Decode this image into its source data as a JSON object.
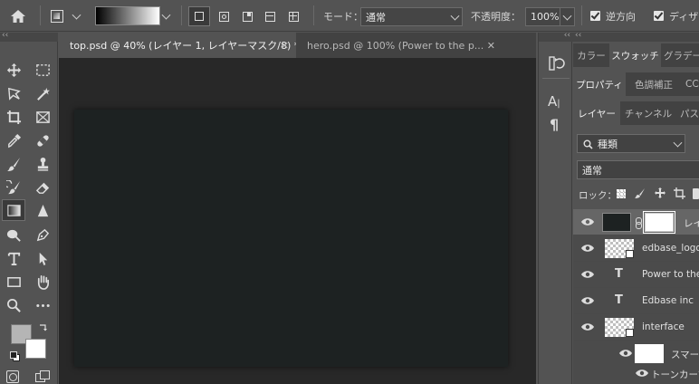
{
  "options_bar": {
    "mode_label": "モード：",
    "mode_value": "通常",
    "opacity_label": "不透明度：",
    "opacity_value": "100%",
    "reverse_label": "逆方向",
    "dither_label": "ディザ"
  },
  "documents": {
    "tabs": [
      {
        "label": "top.psd @ 40% (レイヤー 1, レイヤーマスク/8) *",
        "active": true
      },
      {
        "label": "hero.psd @ 100% (Power to the p...",
        "active": false
      }
    ]
  },
  "panels": {
    "top_tabs": [
      "カラー",
      "スウォッチ",
      "グラデー"
    ],
    "mid_tabs": [
      "プロパティ",
      "色調補正",
      "CC"
    ],
    "layer_tabs": [
      "レイヤー",
      "チャンネル",
      "パス"
    ],
    "filter_kind": "種類",
    "blend_mode": "通常",
    "lock_label": "ロック："
  },
  "layers": [
    {
      "name": "レイ",
      "type": "masked"
    },
    {
      "name": "edbase_logo",
      "type": "smart"
    },
    {
      "name": "Power to the",
      "type": "text"
    },
    {
      "name": "Edbase inc",
      "type": "text"
    },
    {
      "name": "interface",
      "type": "smart"
    },
    {
      "name": "スマー",
      "type": "sub"
    },
    {
      "name": "トーンカーブ",
      "type": "sub"
    }
  ],
  "colors": {
    "foreground": "#b5b5b5",
    "background": "#ffffff",
    "canvas": "#1d2222"
  }
}
